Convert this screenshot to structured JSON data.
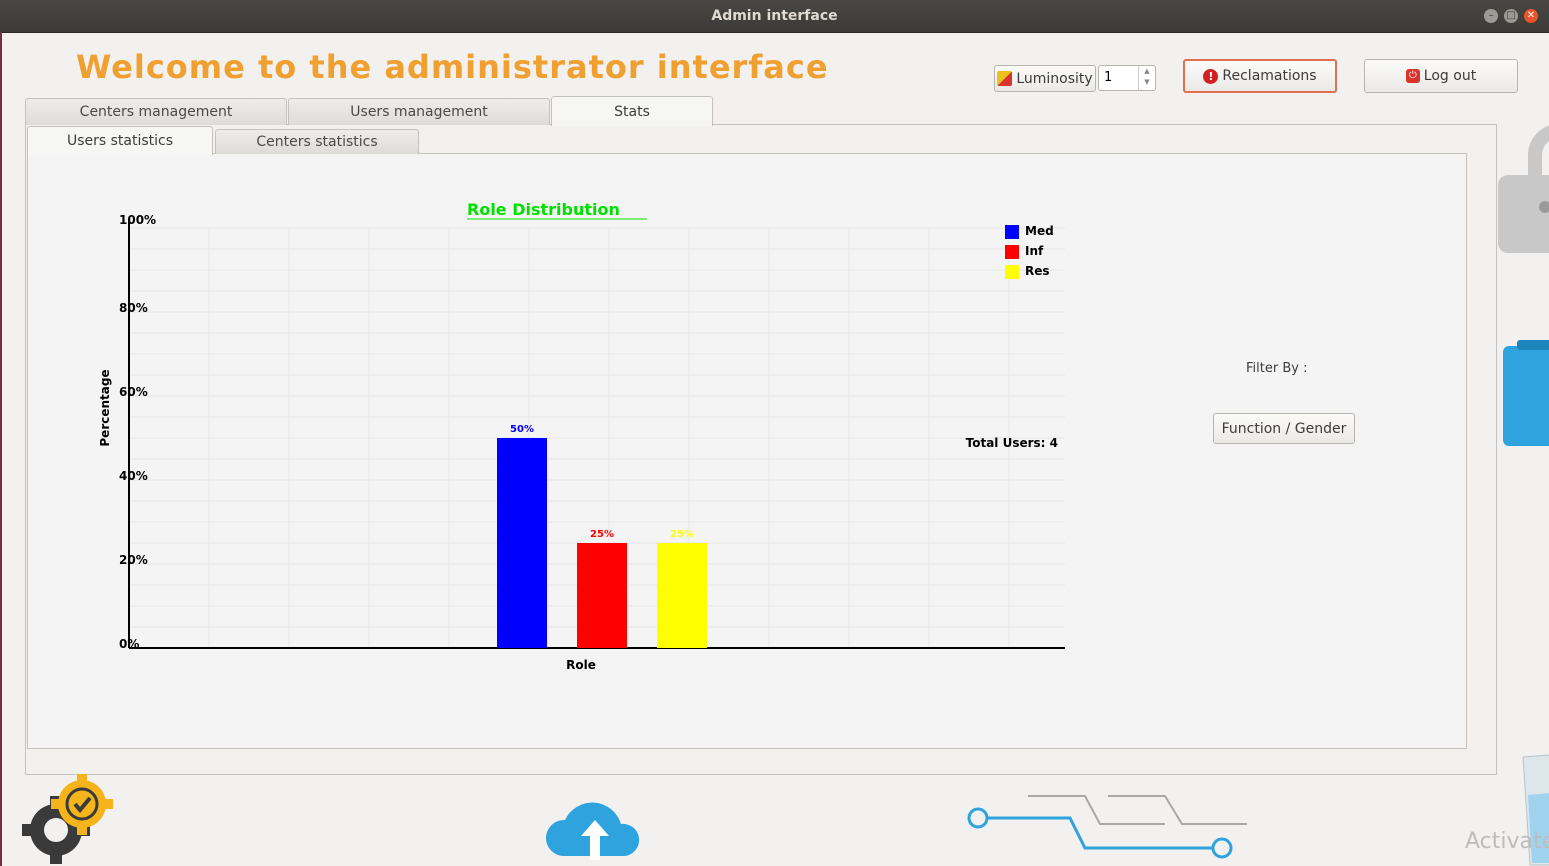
{
  "window": {
    "title": "Admin interface"
  },
  "header": {
    "welcome": "Welcome to the administrator interface",
    "luminosity_label": "Luminosity",
    "luminosity_value": "1",
    "reclamations_label": "Reclamations",
    "logout_label": "Log out"
  },
  "main_tabs": [
    {
      "label": "Centers management",
      "active": false
    },
    {
      "label": "Users management",
      "active": false
    },
    {
      "label": "Stats",
      "active": true
    }
  ],
  "sub_tabs": [
    {
      "label": "Users statistics",
      "active": true
    },
    {
      "label": "Centers statistics",
      "active": false
    }
  ],
  "filter": {
    "label": "Filter By :",
    "button_label": "Function / Gender"
  },
  "total_users_text": "Total Users: 4",
  "watermark": "Activate",
  "colors": {
    "accent": "#f0a030",
    "title_green": "#00e000",
    "danger": "#d32020"
  },
  "icons": [
    "luminosity-icon",
    "alert-icon",
    "power-icon",
    "lock-icon",
    "gear-check-icon",
    "cloud-upload-icon",
    "circuit-icon"
  ],
  "chart_data": {
    "type": "bar",
    "title": "Role Distribution",
    "xlabel": "Role",
    "ylabel": "Percentage",
    "ylim": [
      0,
      100
    ],
    "yticks": [
      "0%",
      "20%",
      "40%",
      "60%",
      "80%",
      "100%"
    ],
    "grid": true,
    "legend_position": "top-right",
    "series": [
      {
        "name": "Med",
        "value": 50,
        "label": "50%",
        "color": "#0000ff"
      },
      {
        "name": "Inf",
        "value": 25,
        "label": "25%",
        "color": "#ff0000"
      },
      {
        "name": "Res",
        "value": 25,
        "label": "25%",
        "color": "#ffff00"
      }
    ]
  }
}
